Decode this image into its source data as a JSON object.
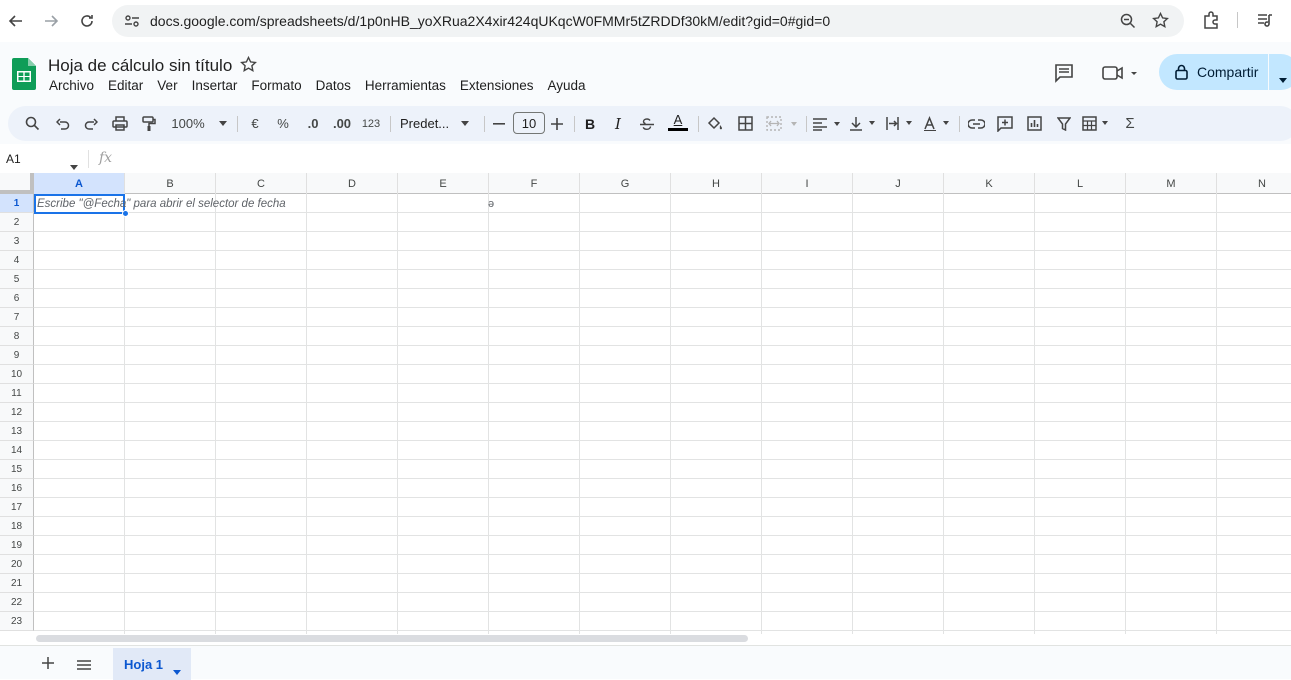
{
  "browser": {
    "url": "docs.google.com/spreadsheets/d/1p0nHB_yoXRua2X4xir424qUKqcW0FMMr5tZRDDf30kM/edit?gid=0#gid=0"
  },
  "header": {
    "title": "Hoja de cálculo sin título",
    "menu": [
      "Archivo",
      "Editar",
      "Ver",
      "Insertar",
      "Formato",
      "Datos",
      "Herramientas",
      "Extensiones",
      "Ayuda"
    ],
    "share_label": "Compartir"
  },
  "toolbar": {
    "zoom": "100%",
    "currency": "€",
    "percent": "%",
    "decrease_decimals": ".0",
    "increase_decimals": ".00",
    "number_format": "123",
    "font": "Predet...",
    "font_size": "10",
    "bold": "B",
    "italic": "I",
    "text_color_letter": "A",
    "sum": "Σ"
  },
  "formula_bar": {
    "name_box": "A1",
    "fx": "fx"
  },
  "grid": {
    "columns": [
      "A",
      "B",
      "C",
      "D",
      "E",
      "F",
      "G",
      "H",
      "I",
      "J",
      "K",
      "L",
      "M",
      "N"
    ],
    "rows": [
      "1",
      "2",
      "3",
      "4",
      "5",
      "6",
      "7",
      "8",
      "9",
      "10",
      "11",
      "12",
      "13",
      "14",
      "15",
      "16",
      "17",
      "18",
      "19",
      "20",
      "21",
      "22",
      "23"
    ],
    "selected_cell": "A1",
    "hint": "Escribe \"@Fecha\" para abrir el selector de fecha"
  },
  "bottom": {
    "sheet_tab": "Hoja 1"
  },
  "colors": {
    "accent": "#0b57d0",
    "selection": "#1a73e8",
    "share_bg": "#c2e7ff",
    "sheets_green": "#0f9d58"
  }
}
